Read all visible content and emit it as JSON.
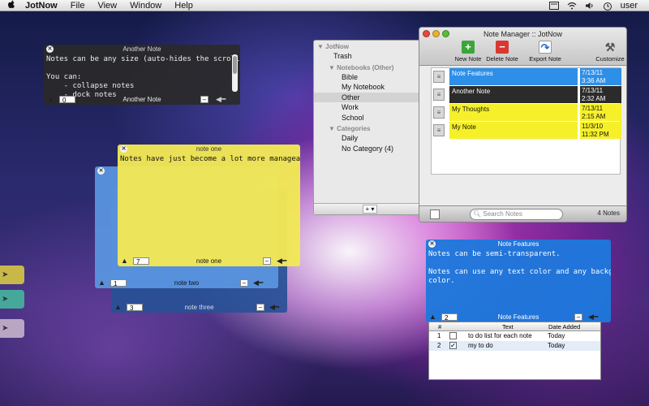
{
  "menubar": {
    "app": "JotNow",
    "items": [
      "File",
      "View",
      "Window",
      "Help"
    ],
    "user": "user"
  },
  "notes": {
    "dark": {
      "title": "Another Note",
      "body": "Notes can be any size (auto-hides the scrollbars).\n\nYou can:\n    - collapse notes\n    - dock notes",
      "count": "0",
      "footer_title": "Another Note",
      "min": "–"
    },
    "yellow": {
      "title": "note one",
      "body": "Notes have just become a lot more manageable.",
      "count": "7",
      "footer_title": "note one",
      "min": "–"
    },
    "blue": {
      "count": "1",
      "footer_title": "note two",
      "min": "–"
    },
    "navy": {
      "count": "3",
      "footer_title": "note three",
      "min": "–"
    },
    "features": {
      "title": "Note Features",
      "body": "Notes can be semi-transparent.\n\nNotes can use any text color and any background\ncolor.",
      "count": "2",
      "footer_title": "Note Features",
      "min": "–"
    }
  },
  "docked_tabs": [
    {
      "color": "#c8b84a"
    },
    {
      "color": "#46a89a"
    },
    {
      "color": "#b8a6c4"
    }
  ],
  "sidebar": {
    "header": "JotNow",
    "trash": "Trash",
    "notebooks_header": "Notebooks (Other)",
    "notebooks": [
      "Bible",
      "My Notebook",
      "Other",
      "Work",
      "School"
    ],
    "selected": "Other",
    "categories_header": "Categories",
    "categories": [
      "Daily",
      "No Category (4)"
    ],
    "add_label": "+ ▾"
  },
  "manager": {
    "title": "Note Manager :: JotNow",
    "toolbar": {
      "new_note": "New Note",
      "delete_note": "Delete Note",
      "export_note": "Export Note",
      "customize": "Customize"
    },
    "rows": [
      {
        "title": "Note Features",
        "date": "7/13/11",
        "time": "3:36 AM",
        "bg": "#2e8fe8",
        "fg": "#ffffff"
      },
      {
        "title": "Another Note",
        "date": "7/13/11",
        "time": "2:32 AM",
        "bg": "#2b2b2b",
        "fg": "#ffffff"
      },
      {
        "title": "My Thoughts",
        "date": "7/13/11",
        "time": "2:15 AM",
        "bg": "#f6f02a",
        "fg": "#111111"
      },
      {
        "title": "My Note",
        "date": "11/3/10",
        "time": "11:32 PM",
        "bg": "#f6f02a",
        "fg": "#111111"
      }
    ],
    "search_placeholder": "Search Notes",
    "count": "4 Notes"
  },
  "todo": {
    "headers": {
      "num": "#",
      "text": "Text",
      "date": "Date Added"
    },
    "rows": [
      {
        "num": "1",
        "checked": false,
        "text": "to do list for each note",
        "date": "Today"
      },
      {
        "num": "2",
        "checked": true,
        "text": "my to do",
        "date": "Today"
      }
    ]
  }
}
